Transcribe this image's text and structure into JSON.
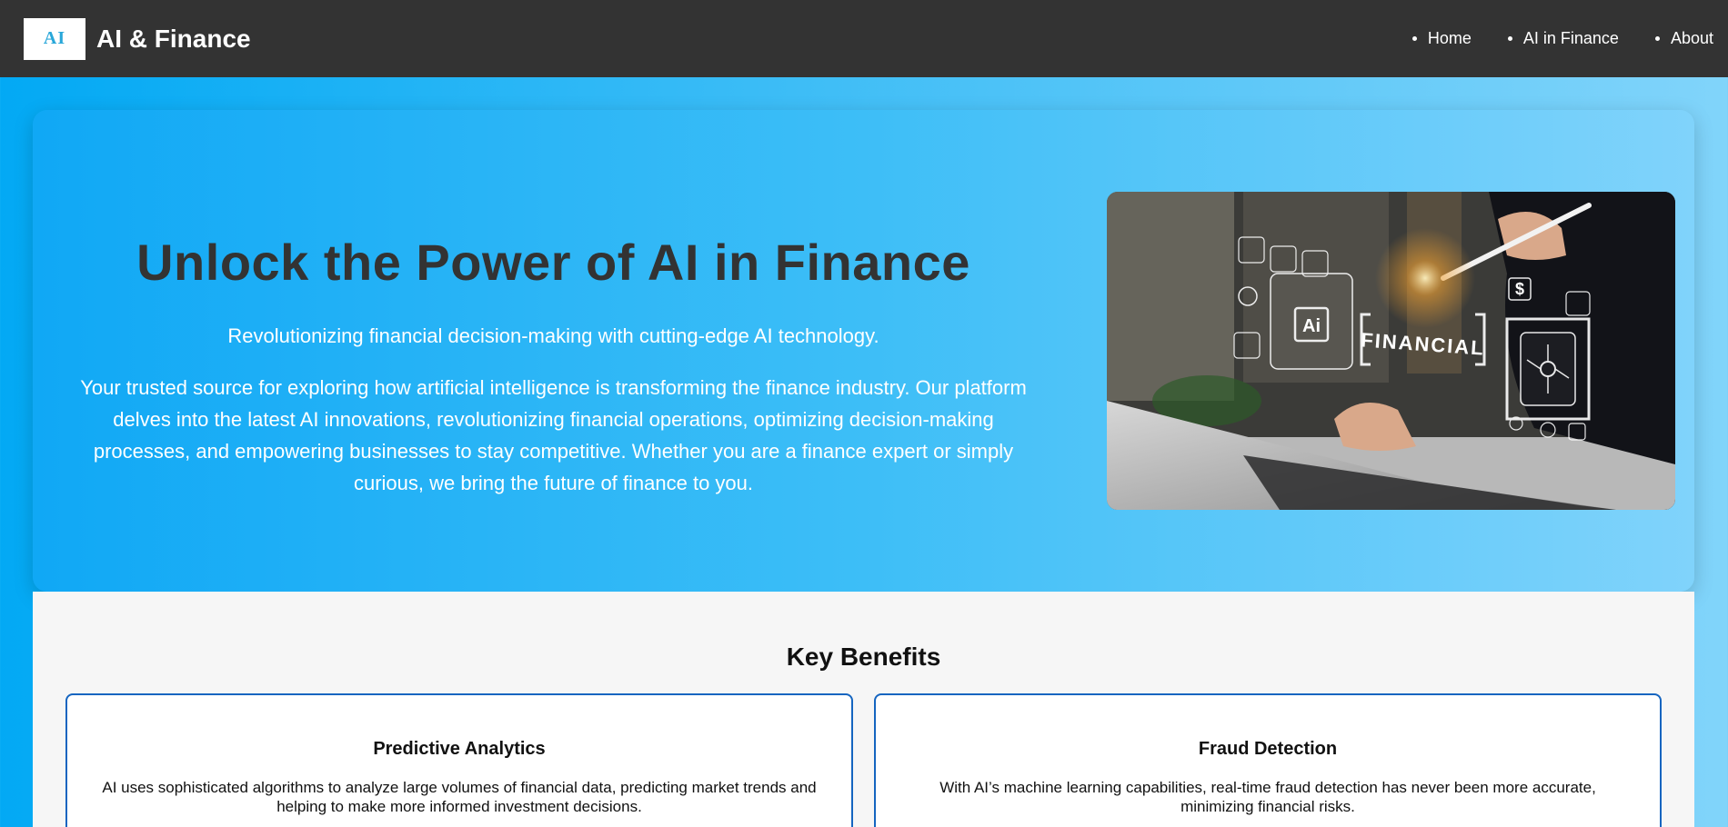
{
  "navbar": {
    "logo_text": "AI",
    "brand": "AI & Finance",
    "links": [
      "Home",
      "AI in Finance",
      "About"
    ]
  },
  "hero": {
    "title": "Unlock the Power of AI in Finance",
    "subtitle": "Revolutionizing financial decision-making with cutting-edge AI technology.",
    "description": "Your trusted source for exploring how artificial intelligence is transforming the finance industry. Our platform delves into the latest AI innovations, revolutionizing financial operations, optimizing decision-making processes, and empowering businesses to stay competitive. Whether you are a finance expert or simply curious, we bring the future of finance to you.",
    "image": {
      "label": "FINANCIAL",
      "chip": "Ai",
      "dollar": "$"
    }
  },
  "benefits": {
    "title": "Key Benefits",
    "cards": [
      {
        "title": "Predictive Analytics",
        "text": "AI uses sophisticated algorithms to analyze large volumes of financial data, predicting market trends and helping to make more informed investment decisions."
      },
      {
        "title": "Fraud Detection",
        "text": "With AI’s machine learning capabilities, real-time fraud detection has never been more accurate, minimizing financial risks."
      }
    ]
  }
}
